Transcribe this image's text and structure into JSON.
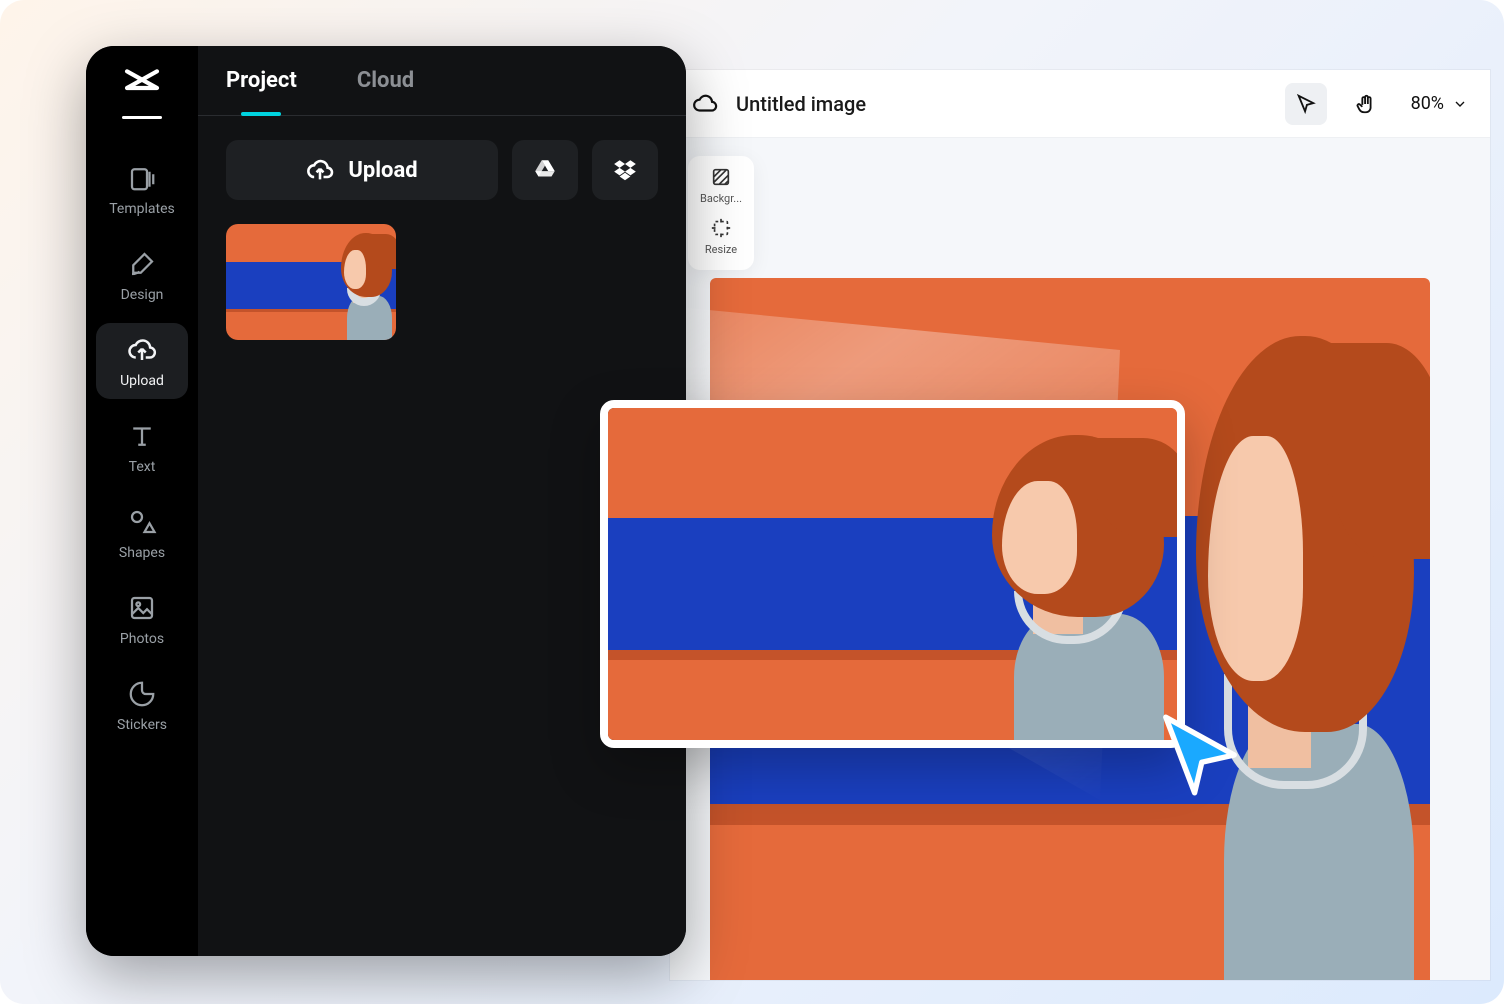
{
  "sidebar": {
    "items": [
      {
        "label": "Templates",
        "icon": "templates"
      },
      {
        "label": "Design",
        "icon": "design"
      },
      {
        "label": "Upload",
        "icon": "upload",
        "active": true
      },
      {
        "label": "Text",
        "icon": "text"
      },
      {
        "label": "Shapes",
        "icon": "shapes"
      },
      {
        "label": "Photos",
        "icon": "photos"
      },
      {
        "label": "Stickers",
        "icon": "stickers"
      }
    ]
  },
  "panel": {
    "tabs": {
      "project": "Project",
      "cloud": "Cloud"
    },
    "upload_label": "Upload",
    "providers": {
      "gdrive": "Google Drive",
      "dropbox": "Dropbox"
    }
  },
  "canvas": {
    "title": "Untitled image",
    "zoom": "80%",
    "tools": {
      "background": "Backgr...",
      "resize": "Resize"
    }
  },
  "colors": {
    "accent_cyan": "#00d4e0",
    "cursor_blue": "#1aa9ff",
    "image_orange": "#e56a3b",
    "image_blue": "#1a3fbf"
  }
}
